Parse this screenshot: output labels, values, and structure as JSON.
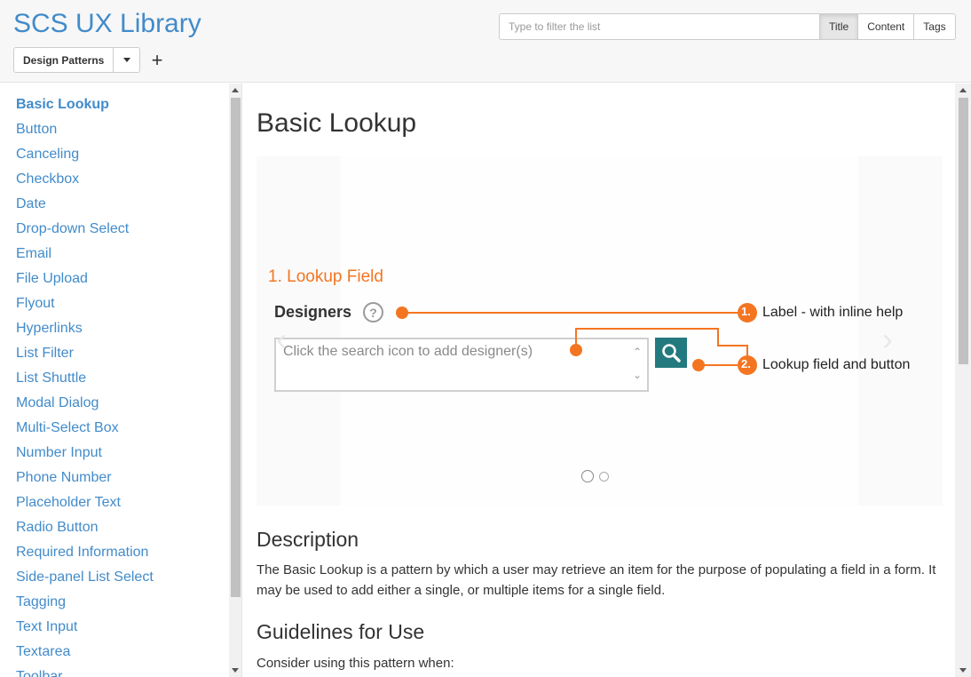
{
  "header": {
    "title": "SCS UX Library",
    "collection_dropdown": "Design Patterns",
    "add_label": "+",
    "filter": {
      "placeholder": "Type to filter the list",
      "modes": [
        "Title",
        "Content",
        "Tags"
      ],
      "active_mode": "Title"
    }
  },
  "sidebar": {
    "items": [
      "Basic Lookup",
      "Button",
      "Canceling",
      "Checkbox",
      "Date",
      "Drop-down Select",
      "Email",
      "File Upload",
      "Flyout",
      "Hyperlinks",
      "List Filter",
      "List Shuttle",
      "Modal Dialog",
      "Multi-Select Box",
      "Number Input",
      "Phone Number",
      "Placeholder Text",
      "Radio Button",
      "Required Information",
      "Side-panel List Select",
      "Tagging",
      "Text Input",
      "Textarea",
      "Toolbar"
    ],
    "active_item": "Basic Lookup"
  },
  "main": {
    "title": "Basic Lookup",
    "carousel": {
      "heading": "1. Lookup Field",
      "field_label": "Designers",
      "help_glyph": "?",
      "field_placeholder": "Click the search icon to add designer(s)",
      "callouts": [
        {
          "number": "1.",
          "text": "Label - with inline help"
        },
        {
          "number": "2.",
          "text": "Lookup field and button"
        }
      ],
      "accent_color": "#f47521",
      "button_color": "#237a7e",
      "slide_count": 2,
      "active_slide": 1
    },
    "description_heading": "Description",
    "description_text": "The Basic Lookup is a pattern by which a user may retrieve an item for the purpose of populating a field in a form. It may be used to add either a single, or multiple items for a single field.",
    "guidelines_heading": "Guidelines for Use",
    "guidelines_intro": "Consider using this pattern when:"
  },
  "colors": {
    "link": "#428bca",
    "accent": "#f47521"
  }
}
